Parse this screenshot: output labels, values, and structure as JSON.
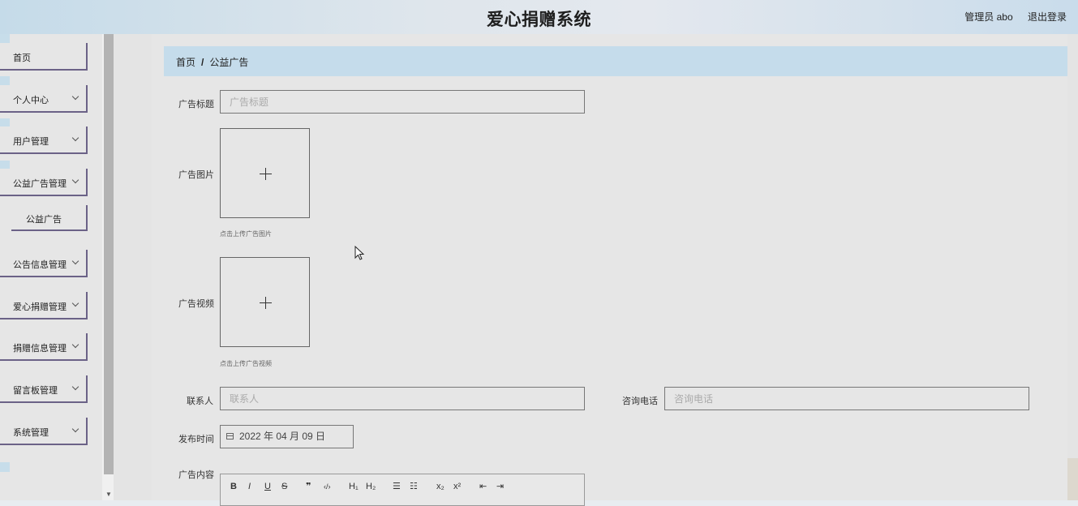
{
  "header": {
    "title": "爱心捐赠系统",
    "user": "管理员 abo",
    "logout": "退出登录"
  },
  "sidebar": {
    "items": [
      {
        "label": "首页"
      },
      {
        "label": "个人中心"
      },
      {
        "label": "用户管理"
      },
      {
        "label": "公益广告管理"
      },
      {
        "label": "公告信息管理"
      },
      {
        "label": "爱心捐赠管理"
      },
      {
        "label": "捐赠信息管理"
      },
      {
        "label": "留言板管理"
      },
      {
        "label": "系统管理"
      }
    ],
    "subitem": {
      "label": "公益广告"
    }
  },
  "breadcrumb": {
    "home": "首页",
    "separator": "/",
    "current": "公益广告"
  },
  "form": {
    "title": {
      "label": "广告标题",
      "placeholder": "广告标题"
    },
    "image": {
      "label": "广告图片",
      "tip": "点击上传广告图片"
    },
    "video": {
      "label": "广告视频",
      "tip": "点击上传广告视频"
    },
    "contact": {
      "label": "联系人",
      "placeholder": "联系人"
    },
    "phone": {
      "label": "咨询电话",
      "placeholder": "咨询电话"
    },
    "date": {
      "label": "发布时间",
      "value": "2022 年 04 月 09 日"
    },
    "content": {
      "label": "广告内容"
    }
  },
  "editor_toolbar": {
    "bold": "B",
    "italic": "I",
    "underline": "U",
    "strike": "S",
    "quote": "❞",
    "code": "‹/›",
    "h1": "H₁",
    "h2": "H₂",
    "ordered_list": "☰",
    "bullet_list": "☷",
    "subscript": "x₂",
    "superscript": "x²",
    "outdent": "⇤",
    "indent": "⇥"
  }
}
